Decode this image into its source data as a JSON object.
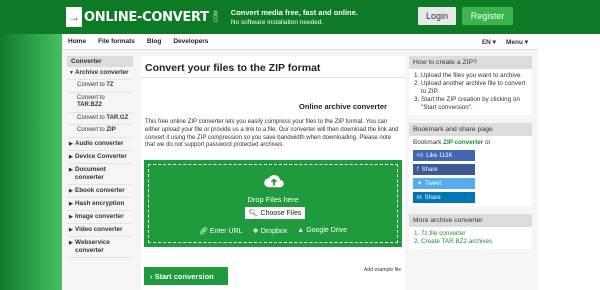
{
  "header": {
    "logo_mark": "→",
    "logo_text": "ONLINE-CONVERT",
    "logo_suffix": ".COM",
    "tagline_bold": "Convert media free, fast and online.",
    "tagline_sub": "No software installation needed.",
    "login_label": "Login",
    "register_label": "Register"
  },
  "nav": {
    "items": [
      "Home",
      "File formats",
      "Blog",
      "Developers"
    ],
    "language": "EN ▾",
    "menu": "Menu ▾"
  },
  "sidebar": {
    "heading": "Converter",
    "archive_label": "Archive converter",
    "sub_items": [
      {
        "prefix": "Convert to ",
        "target": "7Z"
      },
      {
        "prefix": "Convert to ",
        "target": "TAR.BZ2"
      },
      {
        "prefix": "Convert to ",
        "target": "TAR.GZ"
      },
      {
        "prefix": "Convert to ",
        "target": "ZIP"
      }
    ],
    "items": [
      "Audio converter",
      "Device Converter",
      "Document converter",
      "Ebook converter",
      "Hash encryption",
      "Image converter",
      "Video converter",
      "Webservice converter"
    ]
  },
  "main": {
    "title": "Convert your files to the ZIP format",
    "subtitle": "Online archive converter",
    "description": "This free online ZIP converter lets you easily compress your files to the ZIP format. You can either upload your file or provide us a link to a file. Our converter will then download the link and convert it using the ZIP compression so you save bandwidth when downloading. Please note that we do not support password protected archives.",
    "drop_text": "Drop Files here",
    "choose_label": "Choose Files",
    "sources": [
      "Enter URL",
      "Dropbox",
      "Google Drive"
    ],
    "start_label": "› Start conversion",
    "add_example": "Add example file"
  },
  "right": {
    "howto_heading": "How to create a ZIP?",
    "howto_steps": [
      "Upload the files you want to archive.",
      "Upload another archive file to convert to ZIP.",
      "Start the ZIP creation by clicking on \"Start conversion\"."
    ],
    "bookmark_heading": "Bookmark and share page",
    "bookmark_prefix": "Bookmark ",
    "bookmark_link": "ZIP converter",
    "bookmark_suffix": " or",
    "like_label": "Like 113K",
    "share_labels": [
      "Share",
      "Tweet",
      "Share"
    ],
    "more_heading": "More archive converter",
    "more_items": [
      "7z file converter",
      "Create TAR.BZ2 archives"
    ]
  },
  "colors": {
    "brand_green": "#0d7a26",
    "action_green": "#1f9b3d",
    "register_green": "#39b54a",
    "facebook": "#3b5998",
    "twitter": "#55acee",
    "linkedin": "#0077b5"
  }
}
